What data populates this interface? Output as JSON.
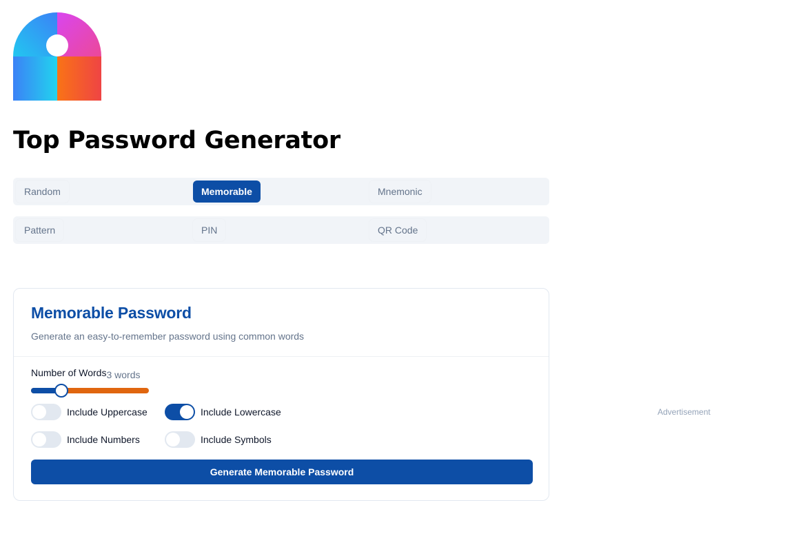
{
  "app": {
    "title": "Top Password Generator",
    "logo_icon": "lock-logo-icon"
  },
  "tabs": {
    "row1": [
      {
        "label": "Random",
        "active": false
      },
      {
        "label": "Memorable",
        "active": true
      },
      {
        "label": "Mnemonic",
        "active": false
      }
    ],
    "row2": [
      {
        "label": "Pattern",
        "active": false
      },
      {
        "label": "PIN",
        "active": false
      },
      {
        "label": "QR Code",
        "active": false
      }
    ]
  },
  "card": {
    "title": "Memorable Password",
    "description": "Generate an easy-to-remember password using common words",
    "words_label": "Number of Words",
    "words_value": "3 words",
    "words_slider_fraction": 0.2,
    "options": [
      {
        "label": "Include Uppercase",
        "checked": false
      },
      {
        "label": "Include Lowercase",
        "checked": true
      },
      {
        "label": "Include Numbers",
        "checked": false
      },
      {
        "label": "Include Symbols",
        "checked": false
      }
    ],
    "generate_label": "Generate Memorable Password"
  },
  "ad": {
    "label": "Advertisement"
  },
  "colors": {
    "accent": "#0d4ea6",
    "slider_track": "#e0660f",
    "tab_bg": "#f1f4f8",
    "muted_text": "#64748b"
  }
}
